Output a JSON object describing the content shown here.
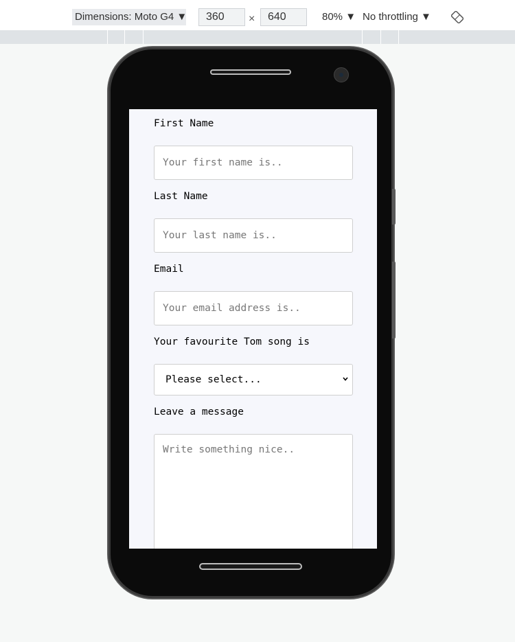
{
  "devtools": {
    "dimensions_label": "Dimensions: Moto G4 ▼",
    "width_value": "360",
    "times_sign": "×",
    "height_value": "640",
    "zoom_label": "80% ▼",
    "throttling_label": "No throttling ▼",
    "rotate_icon": "rotate-icon"
  },
  "form": {
    "first_name": {
      "label": "First Name",
      "placeholder": "Your first name is.."
    },
    "last_name": {
      "label": "Last Name",
      "placeholder": "Your last name is.."
    },
    "email": {
      "label": "Email",
      "placeholder": "Your email address is.."
    },
    "song": {
      "label": "Your favourite Tom song is",
      "selected": "Please select..."
    },
    "message": {
      "label": "Leave a message",
      "placeholder": "Write something nice.."
    }
  }
}
